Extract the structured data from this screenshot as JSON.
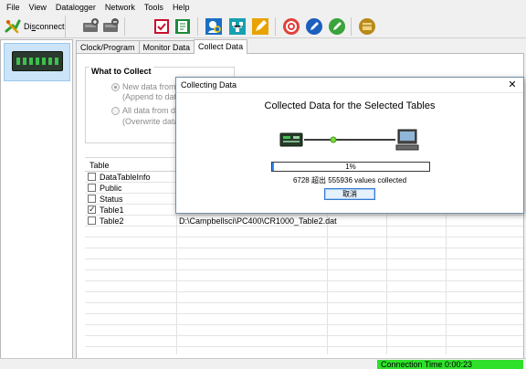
{
  "menu": [
    "File",
    "View",
    "Datalogger",
    "Network",
    "Tools",
    "Help"
  ],
  "toolbar": {
    "disconnect_prefix": "Di",
    "disconnect_underline": "s",
    "disconnect_suffix": "connect",
    "icons": [
      "add-icon",
      "remove-icon",
      "check-document-icon",
      "document-icon",
      "search-user-icon",
      "network-icon",
      "pen-icon",
      "stop-icon",
      "edit-icon",
      "pencil-icon",
      "package-icon"
    ]
  },
  "tabs": [
    "Clock/Program",
    "Monitor Data",
    "Collect Data"
  ],
  "what_to_collect": {
    "title": "What to Collect",
    "opt1": "New data from da",
    "opt1_sub": "(Append to data f",
    "opt2": "All data from dat",
    "opt2_sub": "(Overwrite data fi"
  },
  "table": {
    "header": "Table",
    "rows": [
      {
        "name": "DataTableInfo",
        "checked": false,
        "file": ""
      },
      {
        "name": "Public",
        "checked": false,
        "file": ""
      },
      {
        "name": "Status",
        "checked": false,
        "file": ""
      },
      {
        "name": "Table1",
        "checked": true,
        "file": ""
      },
      {
        "name": "Table2",
        "checked": false,
        "file": "D:\\Campbellsci\\PC400\\CR1000_Table2.dat"
      }
    ]
  },
  "dialog": {
    "title": "Collecting Data",
    "heading": "Collected Data for the Selected Tables",
    "progress_text": "1%",
    "progress": 0.01,
    "status": "6728 超出 555936 values collected",
    "cancel": "取消"
  },
  "status": {
    "connection": "Connection Time 0:00:23"
  },
  "colors": {
    "progress": "#2a8cff",
    "connection": "#2fe02a"
  }
}
